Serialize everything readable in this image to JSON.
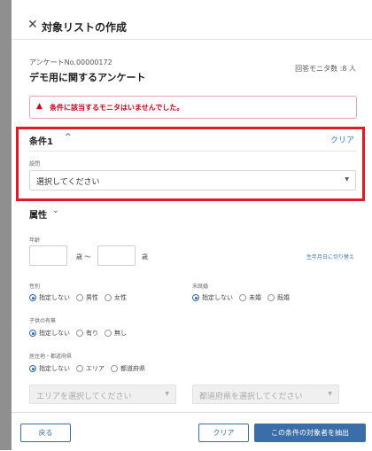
{
  "header": {
    "title": "対象リストの作成"
  },
  "survey": {
    "number": "アンケートNo.00000172",
    "name": "デモ用に関するアンケート",
    "respondents": "回答モニタ数 :8 人"
  },
  "alert": {
    "message": "条件に該当するモニタはいませんでした。"
  },
  "condition": {
    "title": "条件1",
    "clear_label": "クリア",
    "question_label": "設問",
    "select_placeholder": "選択してください"
  },
  "attributes": {
    "title": "属性",
    "age": {
      "label": "年齢",
      "unit_from": "歳 〜",
      "unit_to": "歳",
      "birthday_link": "生年月日に切り替え"
    },
    "gender": {
      "label": "性別",
      "options": [
        "指定しない",
        "男性",
        "女性"
      ],
      "selected": 0
    },
    "marital": {
      "label": "未既婚",
      "options": [
        "指定しない",
        "未婚",
        "既婚"
      ],
      "selected": 0
    },
    "children": {
      "label": "子供の有無",
      "options": [
        "指定しない",
        "有り",
        "無し"
      ],
      "selected": 0
    },
    "residence": {
      "label": "居住地・都道府県",
      "options": [
        "指定しない",
        "エリア",
        "都道府県"
      ],
      "selected": 0,
      "area_placeholder": "エリアを選択してください",
      "pref_placeholder": "都道府県を選択してください"
    }
  },
  "footer": {
    "back_label": "戻る",
    "clear_label": "クリア",
    "extract_label": "この条件の対象者を抽出"
  },
  "colors": {
    "accent": "#3b6ea9",
    "alert": "#d0021b",
    "highlight": "#e01b24"
  }
}
